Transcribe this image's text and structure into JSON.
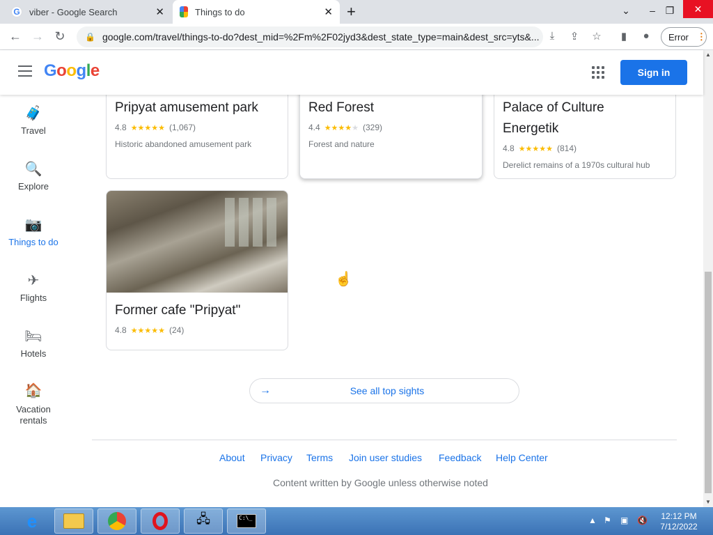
{
  "browser": {
    "tabs": [
      {
        "title": "viber - Google Search",
        "icon": "google-g-icon"
      },
      {
        "title": "Things to do",
        "icon": "google-travel-icon"
      }
    ],
    "url": "google.com/travel/things-to-do?dest_mid=%2Fm%2F02jyd3&dest_state_type=main&dest_src=yts&...",
    "error_label": "Error"
  },
  "header": {
    "logo": "Google",
    "signin_label": "Sign in"
  },
  "sidenav": [
    {
      "label": "Travel",
      "icon": "travel-bag-icon"
    },
    {
      "label": "Explore",
      "icon": "explore-globe-icon"
    },
    {
      "label": "Things to do",
      "icon": "camera-icon",
      "active": true
    },
    {
      "label": "Flights",
      "icon": "airplane-icon"
    },
    {
      "label": "Hotels",
      "icon": "bed-icon"
    },
    {
      "label": "Vacation rentals",
      "icon": "house-icon"
    }
  ],
  "cards": [
    {
      "name": "Pripyat amusement park",
      "rating": "4.8",
      "stars": 5,
      "reviews": "(1,067)",
      "desc": "Historic abandoned amusement park"
    },
    {
      "name": "Red Forest",
      "rating": "4.4",
      "stars": 4.5,
      "reviews": "(329)",
      "desc": "Forest and nature"
    },
    {
      "name": "Palace of Culture Energetik",
      "rating": "4.8",
      "stars": 5,
      "reviews": "(814)",
      "desc": "Derelict remains of a 1970s cultural hub"
    },
    {
      "name": "Former cafe \"Pripyat\"",
      "rating": "4.8",
      "stars": 5,
      "reviews": "(24)"
    }
  ],
  "see_all_label": "See all top sights",
  "footer": {
    "links": [
      "About",
      "Privacy",
      "Terms",
      "Join user studies",
      "Feedback",
      "Help Center"
    ],
    "note": "Content written by Google unless otherwise noted"
  },
  "taskbar": {
    "apps": [
      "internet-explorer-icon",
      "file-explorer-icon",
      "chrome-icon",
      "opera-icon",
      "network-icon",
      "cmd-icon"
    ],
    "time": "12:12 PM",
    "date": "7/12/2022"
  },
  "colors": {
    "accent": "#1a73e8",
    "star": "#fbbc04",
    "taskbar": "#3b72b5"
  }
}
